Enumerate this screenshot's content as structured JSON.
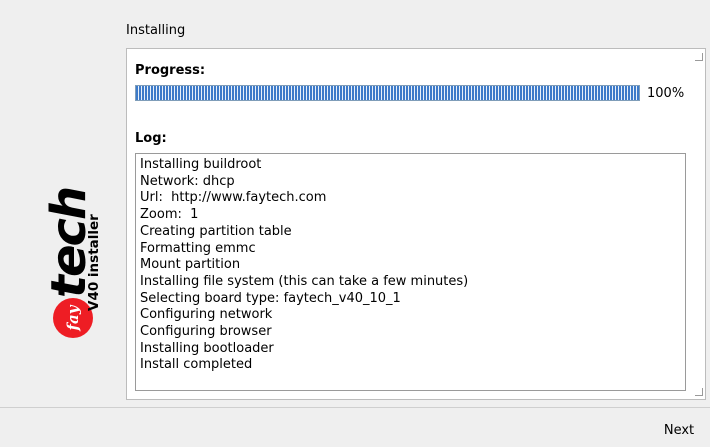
{
  "branding": {
    "logo_badge": "fay",
    "logo_word": "tech",
    "tagline": "V40 installer",
    "badge_color": "#ee1d24"
  },
  "page": {
    "title": "Installing"
  },
  "progress": {
    "label": "Progress:",
    "value": 1.0,
    "percent_text": "100%",
    "fill_color": "#3d7ac9"
  },
  "log": {
    "label": "Log:",
    "lines": [
      "Installing buildroot",
      "Network: dhcp",
      "Url:  http://www.faytech.com",
      "Zoom:  1",
      "Creating partition table",
      "Formatting emmc",
      "Mount partition",
      "Installing file system (this can take a few minutes)",
      "Selecting board type: faytech_v40_10_1",
      "Configuring network",
      "Configuring browser",
      "Installing bootloader",
      "Install completed"
    ]
  },
  "footer": {
    "next_label": "Next"
  }
}
